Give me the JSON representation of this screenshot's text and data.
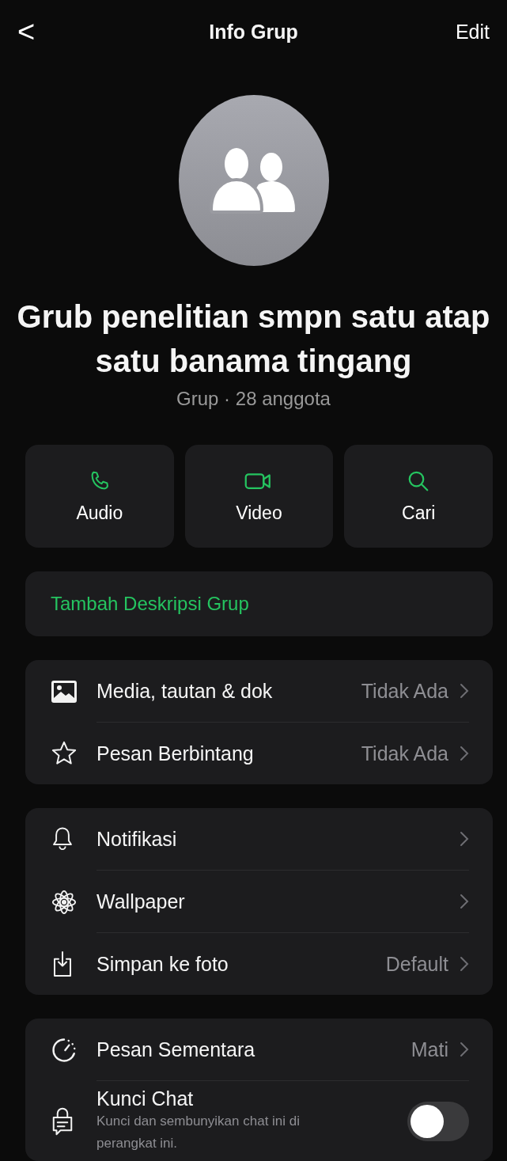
{
  "header": {
    "back": "<",
    "title": "Info Grup",
    "action": "Edit"
  },
  "group": {
    "name": "Grub penelitian smpn satu atap satu banama tingang",
    "meta": "Grup · 28 anggota"
  },
  "actions": [
    {
      "label": "Audio"
    },
    {
      "label": "Video"
    },
    {
      "label": "Cari"
    }
  ],
  "description": {
    "placeholder": "Tambah Deskripsi Grup"
  },
  "sections": [
    {
      "rows": [
        {
          "kind": "nav",
          "label": "Media, tautan & dok",
          "value": "Tidak Ada"
        },
        {
          "kind": "nav",
          "label": "Pesan Berbintang",
          "value": "Tidak Ada"
        }
      ]
    },
    {
      "rows": [
        {
          "kind": "nav",
          "label": "Notifikasi"
        },
        {
          "kind": "nav",
          "label": "Wallpaper"
        },
        {
          "kind": "nav",
          "label": "Simpan ke foto",
          "value": "Default"
        }
      ]
    },
    {
      "rows": [
        {
          "kind": "nav",
          "label": "Pesan Sementara",
          "value": "Mati"
        },
        {
          "kind": "toggle",
          "label": "Kunci Chat",
          "subtitle": "Kunci dan sembunyikan chat ini di perangkat ini.",
          "on": false
        }
      ]
    }
  ]
}
